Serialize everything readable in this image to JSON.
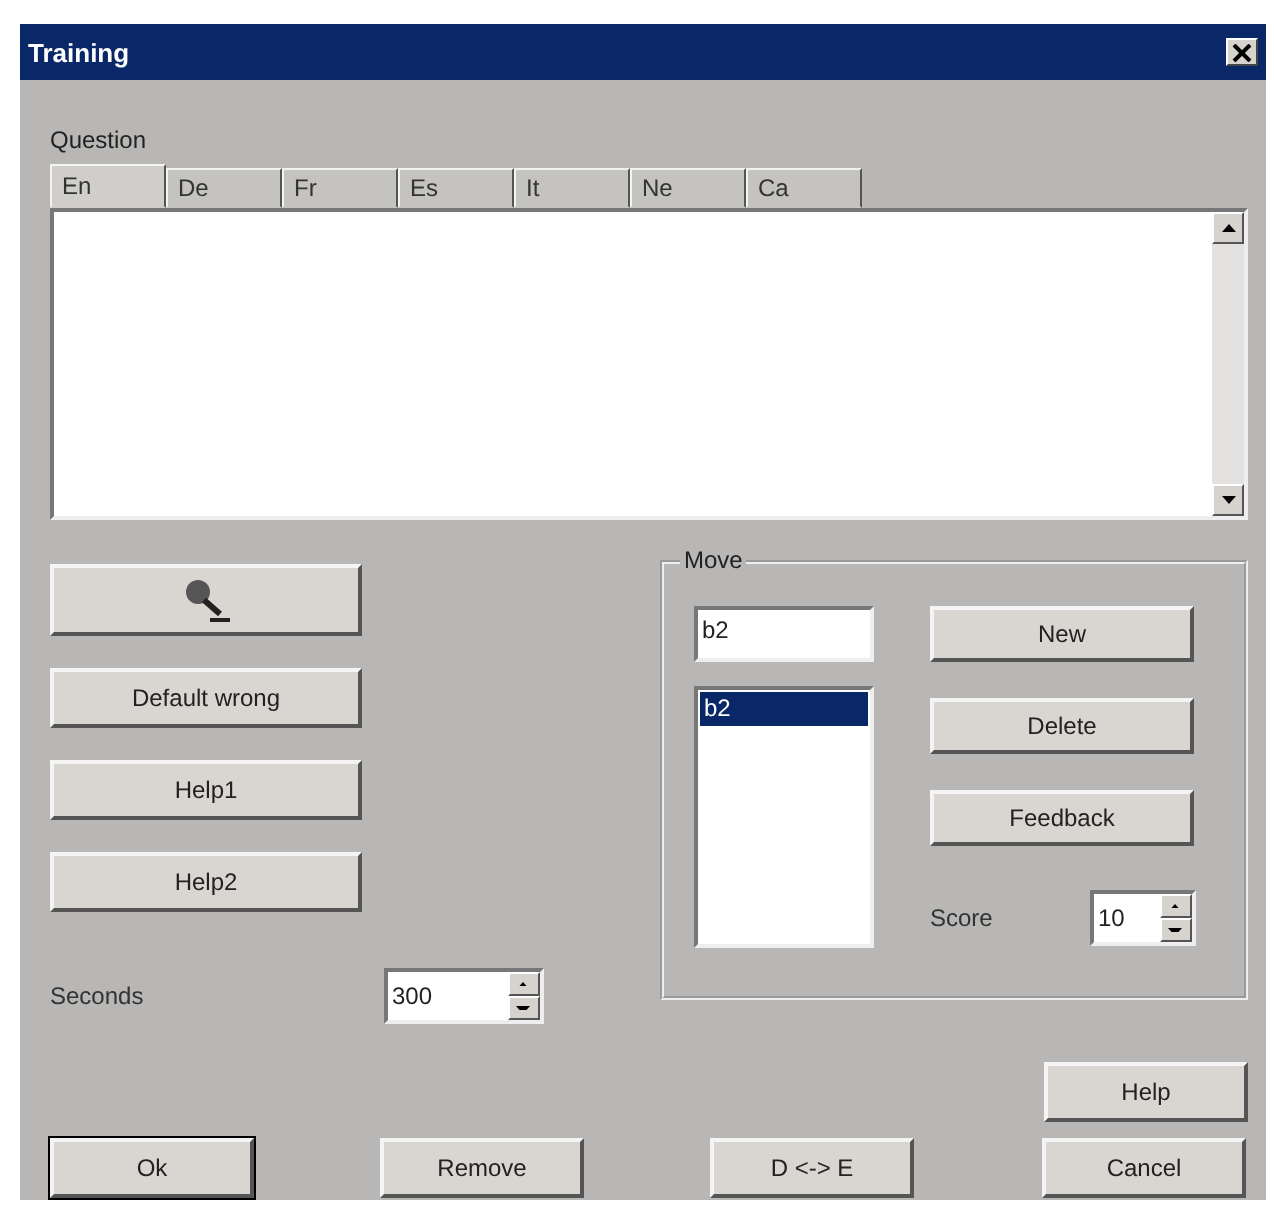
{
  "window": {
    "title": "Training"
  },
  "question": {
    "label": "Question",
    "tabs": [
      {
        "label": "En",
        "selected": true
      },
      {
        "label": "De",
        "selected": false
      },
      {
        "label": "Fr",
        "selected": false
      },
      {
        "label": "Es",
        "selected": false
      },
      {
        "label": "It",
        "selected": false
      },
      {
        "label": "Ne",
        "selected": false
      },
      {
        "label": "Ca",
        "selected": false
      }
    ]
  },
  "side_buttons": [
    {
      "kind": "microphone"
    },
    {
      "kind": "text",
      "label": "Default wrong"
    },
    {
      "kind": "text",
      "label": "Help1"
    },
    {
      "kind": "text",
      "label": "Help2"
    }
  ],
  "seconds": {
    "label": "Seconds",
    "value": "300"
  },
  "move": {
    "title": "Move",
    "input_value": "b2",
    "items": [
      {
        "label": "b2",
        "selected": true
      }
    ],
    "buttons": [
      "New",
      "Delete",
      "Feedback"
    ],
    "score_label": "Score",
    "score_value": "10"
  },
  "help_button": "Help",
  "bottom_buttons": [
    {
      "label": "Ok",
      "default": true
    },
    {
      "label": "Remove",
      "default": false
    },
    {
      "label": "D <-> E",
      "default": false
    },
    {
      "label": "Cancel",
      "default": false
    }
  ]
}
